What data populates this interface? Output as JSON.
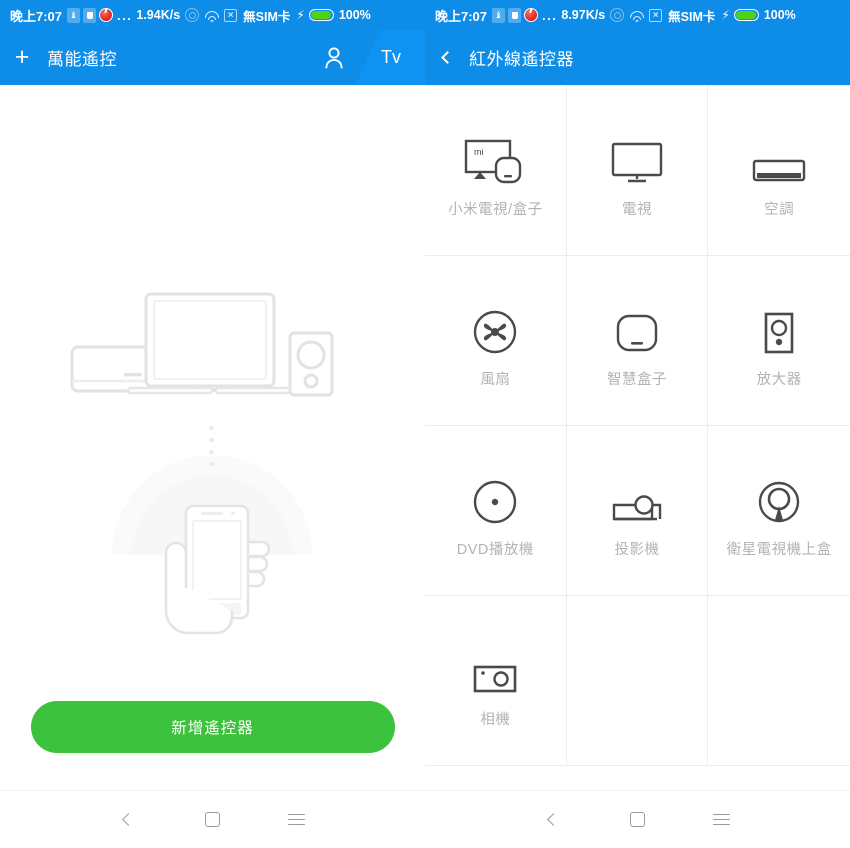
{
  "theme": {
    "status_blue": "#0d8ce8",
    "appbar_blue": "#0d8ce8",
    "accent_green": "#3cc23c",
    "battery_green": "#4fd217",
    "icon_gray": "#4a4a4a",
    "label_gray": "#b3b3b3",
    "divider": "#ededed"
  },
  "left_screen": {
    "statusbar": {
      "time": "晚上7:07",
      "icons": [
        "usb-icon",
        "sd-card-icon",
        "app-notification-icon"
      ],
      "overflow_dots": "...",
      "net_speed": "1.94K/s",
      "circle_icon": "nfc-icon",
      "wifi_icon": "wifi-icon",
      "mute_icon": "☒",
      "sim_text": "無SIM卡",
      "charging_icon": "⚡",
      "battery_icon": "battery-icon",
      "battery_pct": "100%"
    },
    "appbar": {
      "add_icon": "+",
      "title": "萬能遙控",
      "account_icon": "person-icon",
      "tv_button_label": "Tv"
    },
    "illustration": {
      "name": "devices-and-phone-illustration",
      "devices": [
        "air-conditioner",
        "television",
        "speaker"
      ],
      "phone": "hand-holding-phone",
      "signal": "ir-signal-arc",
      "dots": 4
    },
    "primary_button": {
      "label": "新增遙控器"
    },
    "navbar": {
      "back": "back-icon",
      "home": "home-icon",
      "menu": "menu-icon"
    }
  },
  "right_screen": {
    "statusbar": {
      "time": "晚上7:07",
      "icons": [
        "usb-icon",
        "sd-card-icon",
        "app-notification-icon"
      ],
      "overflow_dots": "...",
      "net_speed": "8.97K/s",
      "circle_icon": "nfc-icon",
      "wifi_icon": "wifi-icon",
      "mute_icon": "☒",
      "sim_text": "無SIM卡",
      "charging_icon": "⚡",
      "battery_icon": "battery-icon",
      "battery_pct": "100%"
    },
    "appbar": {
      "back_icon": "chevron-left-icon",
      "title": "紅外線遙控器"
    },
    "device_grid": [
      {
        "label": "小米電視/盒子",
        "icon": "mi-tv-and-box-icon"
      },
      {
        "label": "電視",
        "icon": "television-icon"
      },
      {
        "label": "空調",
        "icon": "air-conditioner-icon"
      },
      {
        "label": "風扇",
        "icon": "fan-icon"
      },
      {
        "label": "智慧盒子",
        "icon": "smart-box-icon"
      },
      {
        "label": "放大器",
        "icon": "amplifier-icon"
      },
      {
        "label": "DVD播放機",
        "icon": "dvd-player-icon"
      },
      {
        "label": "投影機",
        "icon": "projector-icon"
      },
      {
        "label": "衛星電視機上盒",
        "icon": "satellite-set-top-box-icon"
      },
      {
        "label": "相機",
        "icon": "camera-icon"
      }
    ],
    "navbar": {
      "back": "back-icon",
      "home": "home-icon",
      "menu": "menu-icon"
    }
  }
}
